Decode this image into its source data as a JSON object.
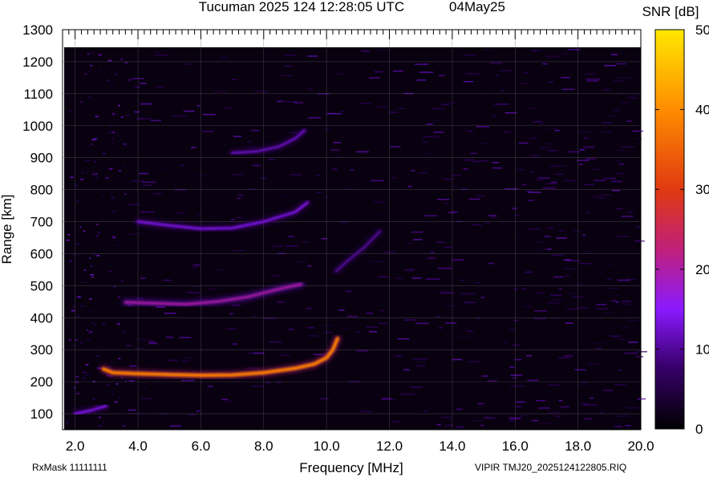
{
  "header": {
    "title": "Tucuman 2025 124 12:28:05 UTC",
    "date": "04May25"
  },
  "footer": {
    "rxmask": "RxMask 11111111",
    "file": "VIPIR  TMJ20_2025124122805.RIQ"
  },
  "colorbar": {
    "label": "SNR [dB]",
    "ticks": [
      "0",
      "10",
      "20",
      "30",
      "40",
      "50"
    ],
    "min": 0,
    "max": 50,
    "colors": [
      "#000000",
      "#3a006e",
      "#8a1aff",
      "#c0207a",
      "#e03a10",
      "#ff8c00",
      "#ffe800"
    ]
  },
  "chart_data": {
    "type": "heatmap",
    "title": "Tucuman 2025 124 12:28:05 UTC",
    "xlabel": "Frequency [MHz]",
    "ylabel": "Range [km]",
    "xlim": [
      1.6,
      20.0
    ],
    "ylim": [
      50,
      1300
    ],
    "xticks": [
      "2.0",
      "4.0",
      "6.0",
      "8.0",
      "10.0",
      "12.0",
      "14.0",
      "16.0",
      "18.0",
      "20.0"
    ],
    "yticks": [
      "100",
      "200",
      "300",
      "400",
      "500",
      "600",
      "700",
      "800",
      "900",
      "1000",
      "1100",
      "1200",
      "1300"
    ],
    "grid": true,
    "traces": [
      {
        "name": "",
        "x": [
          2.9,
          3.2,
          4.0,
          5.0,
          6.0,
          7.0,
          8.0,
          9.0,
          9.6,
          10.0,
          10.2,
          10.35
        ],
        "y": [
          240,
          228,
          225,
          222,
          220,
          221,
          228,
          242,
          255,
          275,
          300,
          335
        ],
        "snr": 38
      },
      {
        "name": "",
        "x": [
          3.6,
          4.5,
          5.5,
          6.5,
          7.5,
          8.5,
          9.2
        ],
        "y": [
          448,
          445,
          442,
          450,
          465,
          490,
          505
        ],
        "snr": 20
      },
      {
        "name": "",
        "x": [
          4.0,
          5.0,
          6.0,
          7.0,
          8.0,
          9.0,
          9.4
        ],
        "y": [
          700,
          688,
          678,
          680,
          700,
          730,
          760
        ],
        "snr": 14
      },
      {
        "name": "",
        "x": [
          7.0,
          7.8,
          8.5,
          9.0,
          9.3
        ],
        "y": [
          915,
          920,
          935,
          960,
          985
        ],
        "snr": 12
      },
      {
        "name": "",
        "x": [
          10.3,
          10.7,
          11.2,
          11.7
        ],
        "y": [
          545,
          580,
          620,
          670
        ],
        "snr": 10
      },
      {
        "name": "",
        "x": [
          2.0,
          2.5,
          3.0
        ],
        "y": [
          100,
          110,
          125
        ],
        "snr": 14
      }
    ]
  }
}
